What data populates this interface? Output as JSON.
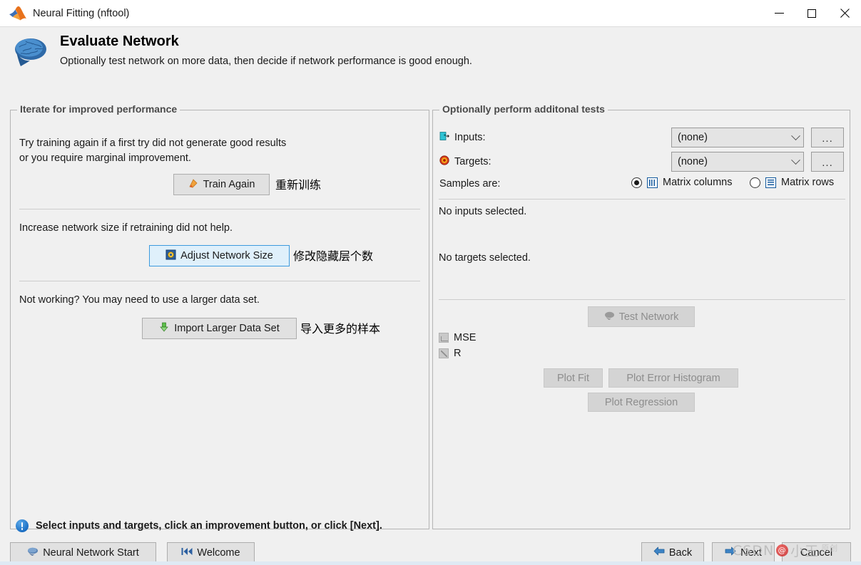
{
  "window": {
    "title": "Neural Fitting (nftool)",
    "logo_icon": "matlab-membrane-icon",
    "minimize_icon": "minimize-icon",
    "maximize_icon": "maximize-icon",
    "close_icon": "close-icon"
  },
  "header": {
    "icon": "brain-icon",
    "title": "Evaluate Network",
    "subtitle": "Optionally test network on more data, then decide if network performance is good enough."
  },
  "left_panel": {
    "legend": "Iterate for improved performance",
    "retrain_text_line1": "Try training again if a first try did not generate good results",
    "retrain_text_line2": "or you require marginal improvement.",
    "train_again_button": "Train Again",
    "train_again_icon": "retrain-icon",
    "train_again_note_cn": "重新训练",
    "increase_text": "Increase network size if retraining did not help.",
    "adjust_button": "Adjust Network Size",
    "adjust_icon": "network-size-icon",
    "adjust_note_cn": "修改隐藏层个数",
    "larger_data_text": "Not working? You may need to use a larger data set.",
    "import_button": "Import Larger Data Set",
    "import_icon": "import-icon",
    "import_note_cn": "导入更多的样本"
  },
  "right_panel": {
    "legend": "Optionally perform additonal tests",
    "inputs_label": "Inputs:",
    "inputs_icon": "inputs-icon",
    "inputs_value": "(none)",
    "inputs_browse": "...",
    "targets_label": "Targets:",
    "targets_icon": "targets-icon",
    "targets_value": "(none)",
    "targets_browse": "...",
    "samples_label": "Samples are:",
    "samples_option_columns": "Matrix columns",
    "samples_option_rows": "Matrix rows",
    "samples_selected": "Matrix columns",
    "no_inputs_status": "No inputs selected.",
    "no_targets_status": "No targets selected.",
    "test_network_button": "Test Network",
    "test_network_icon": "brain-small-icon",
    "mse_label": "MSE",
    "mse_icon": "mse-icon",
    "r_label": "R",
    "r_icon": "r-icon",
    "plot_fit_button": "Plot Fit",
    "plot_error_histogram_button": "Plot Error Histogram",
    "plot_regression_button": "Plot Regression"
  },
  "status": {
    "icon": "info-icon",
    "message": "Select inputs and targets, click an improvement button, or click [Next]."
  },
  "footer": {
    "neural_network_start_button": "Neural Network Start",
    "neural_network_start_icon": "brain-small-icon",
    "welcome_button": "Welcome",
    "welcome_icon": "rewind-icon",
    "back_button": "Back",
    "back_icon": "arrow-left-icon",
    "next_button": "Next",
    "next_icon": "arrow-right-icon",
    "cancel_button": "Cancel"
  },
  "watermark": {
    "text_left": "CSDN",
    "badge": "@",
    "text_right": "小王",
    "suffix": "原创"
  },
  "colors": {
    "accent_blue": "#3c9ade",
    "panel_bg": "#f0f0f0",
    "button_bg": "#e1e1e1",
    "disabled_text": "#8d8d8d",
    "targets_red": "#d93a1e",
    "inputs_teal": "#1fb5c4"
  }
}
